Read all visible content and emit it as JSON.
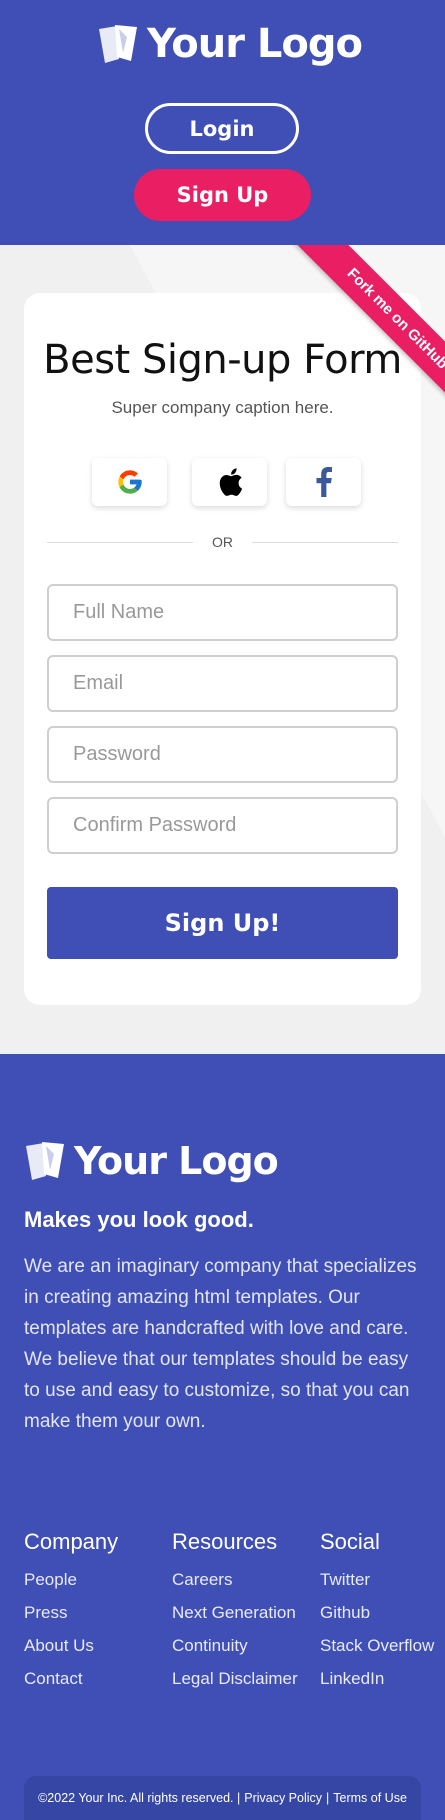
{
  "header": {
    "logo_text": "Your Logo",
    "login_label": "Login",
    "signup_label": "Sign Up"
  },
  "ribbon": {
    "text": "Fork me on GitHub"
  },
  "form": {
    "title": "Best Sign-up Form",
    "caption": "Super company caption here.",
    "social": [
      {
        "icon": "google-icon"
      },
      {
        "icon": "apple-icon"
      },
      {
        "icon": "facebook-icon"
      }
    ],
    "divider_text": "OR",
    "fields": {
      "full_name_placeholder": "Full Name",
      "email_placeholder": "Email",
      "password_placeholder": "Password",
      "confirm_password_placeholder": "Confirm Password"
    },
    "submit_label": "Sign Up!"
  },
  "footer": {
    "logo_text": "Your Logo",
    "tagline": "Makes you look good.",
    "about": "We are an imaginary company that specializes in creating amazing html templates. Our templates are handcrafted with love and care. We believe that our templates should be easy to use and easy to customize, so that you can make them your own.",
    "columns": [
      {
        "title": "Company",
        "links": [
          "People",
          "Press",
          "About Us",
          "Contact"
        ]
      },
      {
        "title": "Resources",
        "links": [
          "Careers",
          "Next Generation",
          "Continuity",
          "Legal Disclaimer"
        ]
      },
      {
        "title": "Social",
        "links": [
          "Twitter",
          "Github",
          "Stack Overflow",
          "LinkedIn"
        ]
      }
    ],
    "copyright": "©2022 Your Inc. All rights reserved. |",
    "privacy_label": "Privacy Policy",
    "separator": "|",
    "terms_label": "Terms of Use"
  },
  "colors": {
    "primary": "#3f4fb5",
    "accent": "#e91e63",
    "background": "#f0f0f0"
  }
}
